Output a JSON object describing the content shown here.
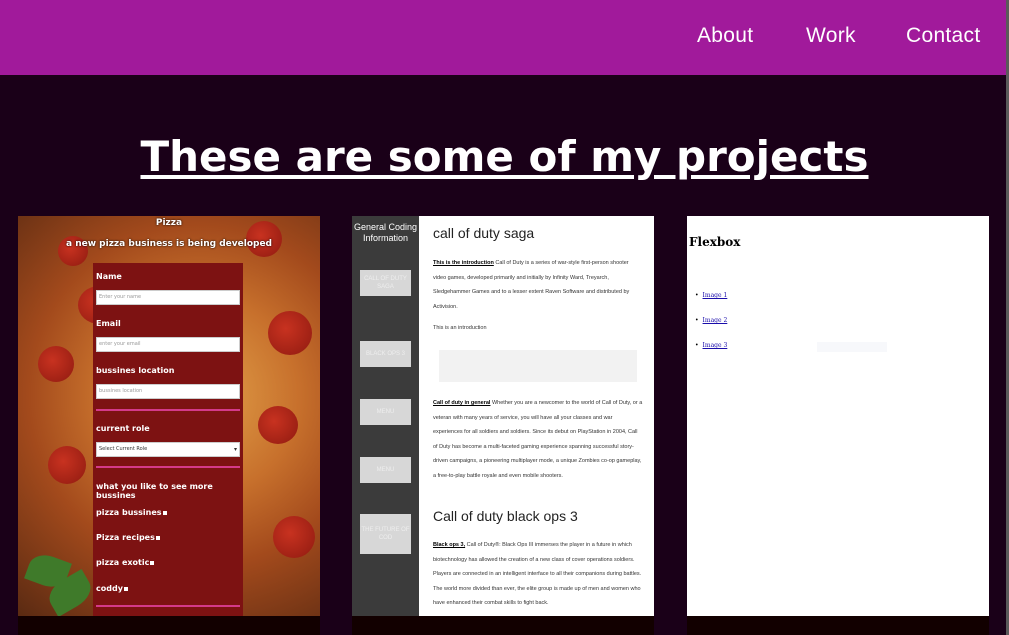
{
  "nav": {
    "about": "About",
    "work": "Work",
    "contact": "Contact"
  },
  "heading": "These are some of my projects",
  "pizza": {
    "title": "Pizza",
    "subtitle": "a new pizza business is being developed",
    "fields": [
      {
        "label": "Name",
        "placeholder": "Enter your name"
      },
      {
        "label": "Email",
        "placeholder": "enter your email"
      },
      {
        "label": "bussines location",
        "placeholder": "bussines location"
      }
    ],
    "role_label": "current role",
    "role_value": "Select Current Role",
    "more_label": "what you like to see more bussines",
    "options": [
      "pizza bussines",
      "Pizza recipes",
      "pizza exotic",
      "coddy"
    ]
  },
  "cod": {
    "side_title": "General Coding Information",
    "side_buttons": [
      "CALL OF DUTY SAGA",
      "BLACK OPS 3",
      "MENU",
      "MENU",
      "THE FUTURE OF COD"
    ],
    "title": "call of duty saga",
    "intro_bold": "This is the introduction",
    "intro_text": " Call of Duty is a series of war-style first-person shooter video games, developed primarily and initially by Infinity Ward, Treyarch, Sledgehammer Games and to a lesser extent Raven Software and distributed by Activision.",
    "intro_line": "This is an introduction",
    "general_bold": "Call of duty in general",
    "general_text": " Whether you are a newcomer to the world of Call of Duty, or a veteran with many years of service, you will have all your classes and war experiences for all soldiers and soldiers. Since its debut on PlayStation in 2004, Call of Duty has become a multi-faceted gaming experience spanning successful story-driven campaigns, a pioneering multiplayer mode, a unique Zombies co-op gameplay, a free-to-play battle royale and even mobile shooters.",
    "h2": "Call of duty black ops 3",
    "bo3_bold": "Black ops 3,",
    "bo3_text": " Call of Duty®: Black Ops III immerses the player in a future in which biotechnology has allowed the creation of a new class of cover operations soldiers. Players are connected in an intelligent interface to all their companions during battles. The world more divided than ever, the elite group is made up of men and women who have enhanced their combat skills to fight back."
  },
  "flex": {
    "title": "Flexbox",
    "items": [
      "Image 1",
      "Image 2",
      "Image 3"
    ]
  }
}
